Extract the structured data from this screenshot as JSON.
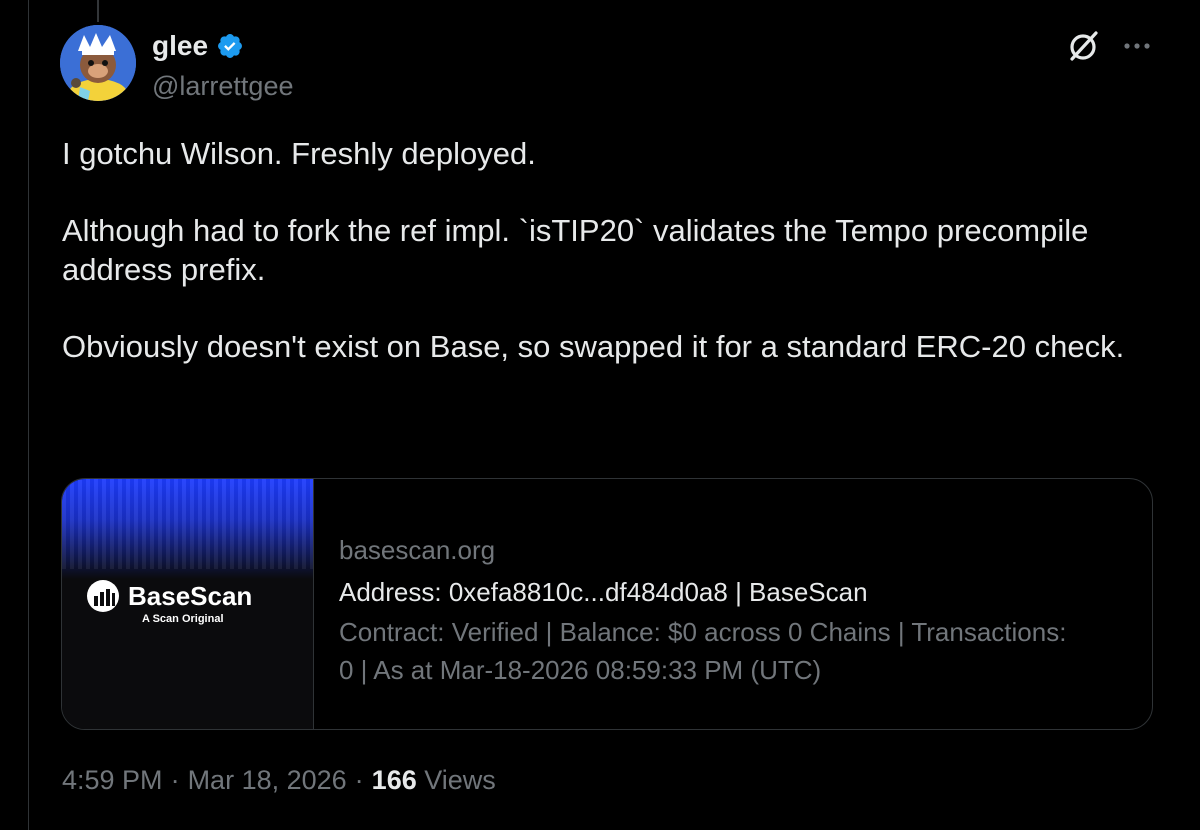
{
  "author": {
    "display_name": "glee",
    "handle": "@larrettgee",
    "verified_icon": "verified-badge-icon",
    "verified_color": "#1d9bf0"
  },
  "header_icons": {
    "grok": "grok-icon",
    "more": "more-options-icon"
  },
  "tweet": {
    "paragraphs": [
      "I gotchu Wilson. Freshly deployed.",
      "Although had to fork the ref impl. `isTIP20` validates the Tempo precompile address prefix.",
      "Obviously doesn't exist on Base, so swapped it for a standard ERC-20 check."
    ]
  },
  "link_card": {
    "thumbnail": {
      "brand_name": "BaseScan",
      "brand_subtitle": "A Scan Original"
    },
    "domain": "basescan.org",
    "title": "Address: 0xefa8810c...df484d0a8 | BaseScan",
    "description": "Contract: Verified | Balance: $0 across 0 Chains | Transactions: 0 | As at Mar-18-2026 08:59:33 PM (UTC)"
  },
  "meta": {
    "time": "4:59 PM",
    "separator": "·",
    "date": "Mar 18, 2026",
    "views_count": "166",
    "views_label": "Views"
  },
  "colors": {
    "background": "#000000",
    "primary_text": "#e7e9ea",
    "secondary_text": "#71767b",
    "border": "#2f3336",
    "accent_blue": "#1d3cff"
  }
}
